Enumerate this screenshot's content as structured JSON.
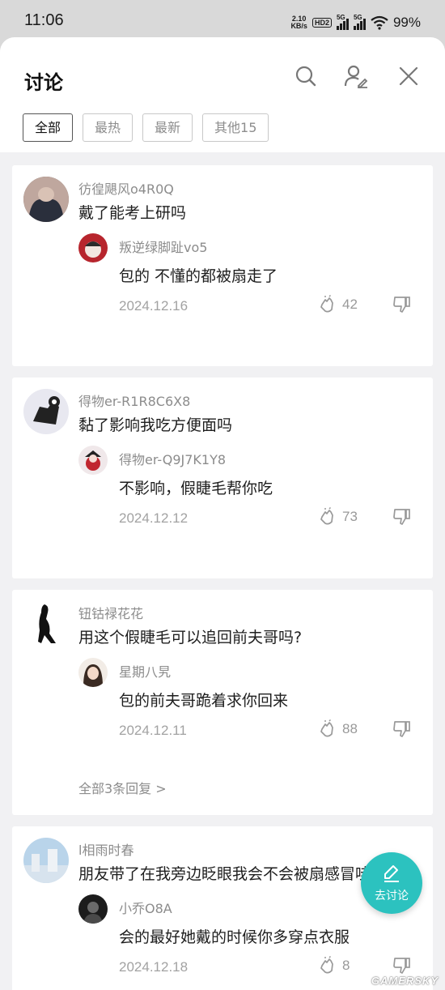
{
  "status_bar": {
    "time": "11:06",
    "net_speed_value": "2.10",
    "net_speed_unit": "KB/s",
    "hd_badge": "HD2",
    "signal_1_label": "5G",
    "signal_2_label": "5G",
    "battery": "99%"
  },
  "header": {
    "title": "讨论",
    "tabs": [
      "全部",
      "最热",
      "最新",
      "其他15"
    ],
    "active_tab": "全部"
  },
  "comments": [
    {
      "user": "彷徨飓风o4R0Q",
      "text": "戴了能考上研吗",
      "reply": {
        "user": "叛逆绿脚趾vo5",
        "text": "包的 不懂的都被扇走了"
      },
      "date": "2024.12.16",
      "likes": "42"
    },
    {
      "user": "得物er-R1R8C6X8",
      "text": "黏了影响我吃方便面吗",
      "reply": {
        "user": "得物er-Q9J7K1Y8",
        "text": "不影响，假睫毛帮你吃"
      },
      "date": "2024.12.12",
      "likes": "73"
    },
    {
      "user": "钮钴禄花花",
      "text": "用这个假睫毛可以追回前夫哥吗?",
      "reply": {
        "user": "星期八旯",
        "text": "包的前夫哥跪着求你回来"
      },
      "date": "2024.12.11",
      "likes": "88",
      "more_replies": "全部3条回复 >"
    },
    {
      "user": "l相雨时春",
      "text": "朋友带了在我旁边眨眼我会不会被扇感冒哇",
      "reply": {
        "user": "小乔O8A",
        "text": "会的最好她戴的时候你多穿点衣服"
      },
      "date": "2024.12.18",
      "likes": "8"
    }
  ],
  "fab": {
    "label": "去讨论"
  },
  "watermark": "GAMERSKY",
  "colors": {
    "accent": "#2cc2bf",
    "muted_text": "#8c8c8c",
    "background": "#f1f1f3"
  },
  "icons": [
    "search-icon",
    "user-edit-icon",
    "close-icon",
    "clap-icon",
    "dislike-icon",
    "pencil-icon",
    "wifi-icon"
  ]
}
